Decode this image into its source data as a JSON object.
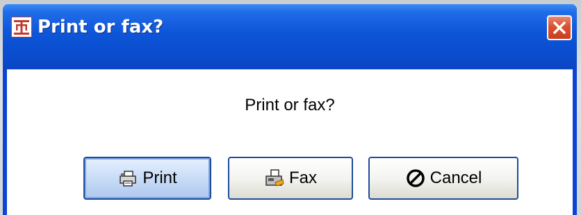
{
  "dialog": {
    "title": "Print or fax?",
    "message": "Print or fax?",
    "app_icon": "app-logo-icon",
    "close_icon": "close-icon"
  },
  "buttons": [
    {
      "label": "Print",
      "icon": "printer-icon",
      "default": true
    },
    {
      "label": "Fax",
      "icon": "fax-icon",
      "default": false
    },
    {
      "label": "Cancel",
      "icon": "cancel-icon",
      "default": false
    }
  ],
  "colors": {
    "titlebar": "#0a4ccd",
    "close_button": "#d9512d",
    "default_button": "#c9dcf7"
  }
}
